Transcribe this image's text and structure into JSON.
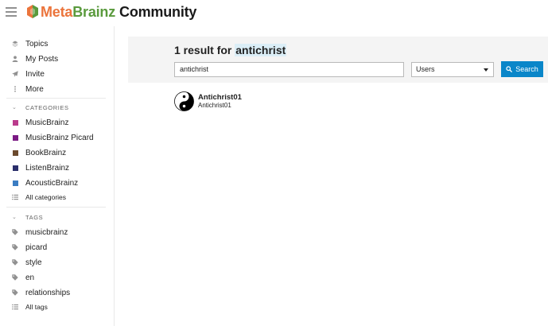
{
  "header": {
    "brand_meta": "Meta",
    "brand_brainz": "Brainz",
    "brand_community": "Community"
  },
  "sidebar": {
    "nav": [
      {
        "label": "Topics",
        "icon": "layers-icon"
      },
      {
        "label": "My Posts",
        "icon": "user-icon"
      },
      {
        "label": "Invite",
        "icon": "paper-plane-icon"
      },
      {
        "label": "More",
        "icon": "more-icon"
      }
    ],
    "categories_heading": "CATEGORIES",
    "categories": [
      {
        "label": "MusicBrainz",
        "color": "#ba3b8c"
      },
      {
        "label": "MusicBrainz Picard",
        "color": "#7b1a84"
      },
      {
        "label": "BookBrainz",
        "color": "#6b4a2d"
      },
      {
        "label": "ListenBrainz",
        "color": "#2b2f6b"
      },
      {
        "label": "AcousticBrainz",
        "color": "#3a7cc2"
      }
    ],
    "all_categories": "All categories",
    "tags_heading": "TAGS",
    "tags": [
      "musicbrainz",
      "picard",
      "style",
      "en",
      "relationships"
    ],
    "all_tags": "All tags"
  },
  "search": {
    "result_prefix": "1 result for",
    "term": "antichrist",
    "input_value": "antichrist",
    "type_selected": "Users",
    "button_label": "Search"
  },
  "results": [
    {
      "name": "Antichrist01",
      "username": "Antichrist01",
      "avatar": "yin-yang-icon"
    }
  ],
  "colors": {
    "accent": "#0a86c9",
    "panel": "#f4f4f4"
  }
}
